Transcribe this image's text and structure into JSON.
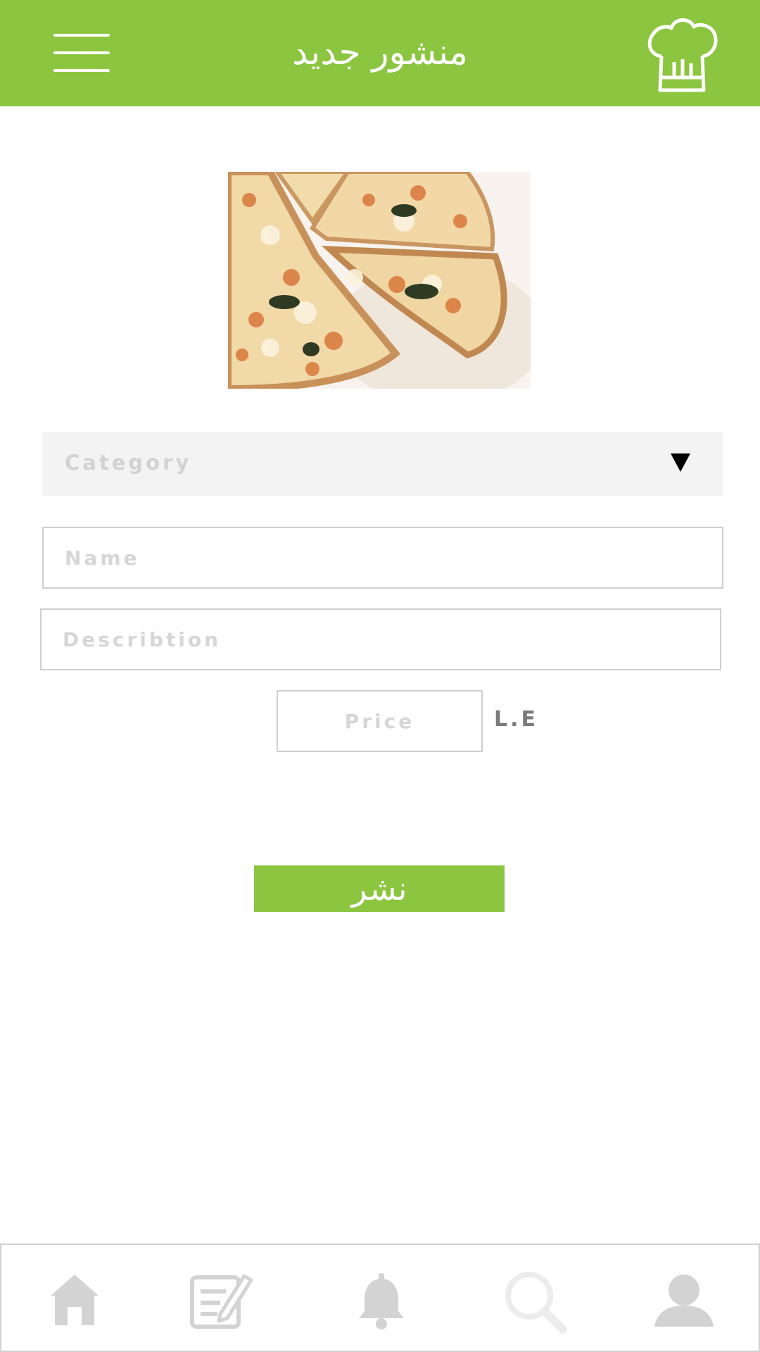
{
  "header": {
    "title": "منشور جديد",
    "menu_icon": "hamburger-menu-icon",
    "chef_icon": "chef-hat-icon"
  },
  "post_image": {
    "subject": "pizza"
  },
  "form": {
    "category_placeholder": "Category",
    "name_placeholder": "Name",
    "description_placeholder": "Describtion",
    "price_placeholder": "Price",
    "currency": "L.E",
    "publish_label": "نشر"
  },
  "bottom_nav": {
    "items": [
      "home-icon",
      "edit-post-icon",
      "bell-icon",
      "search-icon",
      "profile-icon"
    ]
  },
  "colors": {
    "accent": "#8cc540",
    "placeholder": "#d6d6d6",
    "nav_icon": "#d3d3d3"
  }
}
